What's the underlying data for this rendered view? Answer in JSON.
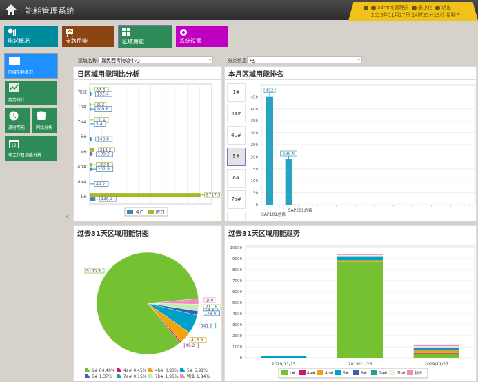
{
  "header": {
    "title": "能耗管理系统",
    "user": "admin[管理员",
    "minimize": "最小化",
    "logout": "退出",
    "datetime": "2019年11月27日 14时35分19秒 星期三"
  },
  "nav": [
    {
      "label": "能耗概况",
      "color": "#008b9d"
    },
    {
      "label": "支路用能",
      "color": "#8b4513"
    },
    {
      "label": "区域用能",
      "color": "#2e8b57"
    },
    {
      "label": "系统设置",
      "color": "#c000c0"
    }
  ],
  "sidebar": [
    "区域能耗概况",
    "趋势统计",
    "逐时用能",
    "同比分析",
    "非工作日用能分析"
  ],
  "filters": {
    "building_label": "建筑名称:",
    "building_value": "嘉民西青物流中心",
    "category_label": "分类信息:",
    "category_value": "电"
  },
  "panels": {
    "daily": "日区域用能同比分析",
    "ranking": "本月区域用能排名",
    "pie": "过去31天区域用能饼图",
    "trend": "过去31天区域用能趋势"
  },
  "ranking_buttons": [
    "1#",
    "4a#",
    "4b#",
    "5#",
    "6#",
    "7a#"
  ],
  "ranking_selected": "5#",
  "chart_data": [
    {
      "type": "bar",
      "orientation": "horizontal",
      "title": "日区域用能同比分析",
      "categories": [
        "1#",
        "4a#",
        "4b#",
        "5#",
        "6#",
        "7a#",
        "7b#",
        "物业"
      ],
      "series": [
        {
          "name": "今日",
          "color": "#3d85b8",
          "values": [
            446.4,
            49.2,
            202.8,
            199.2,
            148.8,
            5.4,
            109.6,
            132.4
          ]
        },
        {
          "name": "昨日",
          "color": "#a8b828",
          "values": [
            8717.5,
            null,
            180.8,
            343.2,
            null,
            11.4,
            102,
            67.6
          ]
        }
      ],
      "xlim": [
        0,
        9600
      ],
      "legend": "bottom"
    },
    {
      "type": "bar",
      "title": "本月区域用能排名",
      "categories": [
        "SAP101总表",
        "SAP201总表",
        "",
        "",
        "",
        "",
        "",
        "",
        "",
        "",
        ""
      ],
      "values": [
        452,
        189.6,
        null,
        null,
        null,
        null,
        null,
        null,
        null,
        null,
        null
      ],
      "ylim": [
        0,
        500
      ],
      "yticks": [
        0,
        50,
        100,
        150,
        200,
        250,
        300,
        350,
        400,
        450
      ],
      "color": "#2aa3c2"
    },
    {
      "type": "pie",
      "title": "过去31天区域用能饼图",
      "categories": [
        "1#",
        "4a#",
        "4b#",
        "5#",
        "6#",
        "7a#",
        "7b#",
        "物业"
      ],
      "values": [
        9163.9,
        49.2,
        415.6,
        641.6,
        148.6,
        16.8,
        211.6,
        200
      ],
      "legend_labels": [
        "1# 84.48%",
        "4a# 0.45%",
        "4b# 3.83%",
        "5# 5.91%",
        "6# 1.37%",
        "7a# 0.15%",
        "7b# 1.95%",
        "物业 1.84%"
      ],
      "colors": [
        "#74c131",
        "#d4146e",
        "#f0a30a",
        "#00a0c8",
        "#3d5fb5",
        "#1ba39a",
        "#c3ecb0",
        "#f28cc0"
      ]
    },
    {
      "type": "bar",
      "stacked": true,
      "title": "过去31天区域用能趋势",
      "categories": [
        "2019/11/25",
        "2019/11/26",
        "2019/11/27"
      ],
      "series": [
        {
          "name": "1#",
          "values": [
            0,
            8700,
            400
          ]
        },
        {
          "name": "4a#",
          "values": [
            0,
            0,
            50
          ]
        },
        {
          "name": "4b#",
          "values": [
            0,
            150,
            220
          ]
        },
        {
          "name": "5#",
          "values": [
            150,
            350,
            150
          ]
        },
        {
          "name": "6#",
          "values": [
            0,
            0,
            100
          ]
        },
        {
          "name": "7a#",
          "values": [
            0,
            20,
            30
          ]
        },
        {
          "name": "7b#",
          "values": [
            0,
            100,
            100
          ]
        },
        {
          "name": "物业",
          "values": [
            0,
            100,
            150
          ]
        }
      ],
      "colors": [
        "#74c131",
        "#d4146e",
        "#f0a30a",
        "#00a0c8",
        "#3d5fb5",
        "#1ba39a",
        "#e8f5e0",
        "#f28cc0"
      ],
      "ylim": [
        0,
        10000
      ],
      "yticks": [
        0,
        1000,
        2000,
        3000,
        4000,
        5000,
        6000,
        7000,
        8000,
        9000,
        10000
      ],
      "legend": "bottom"
    }
  ]
}
